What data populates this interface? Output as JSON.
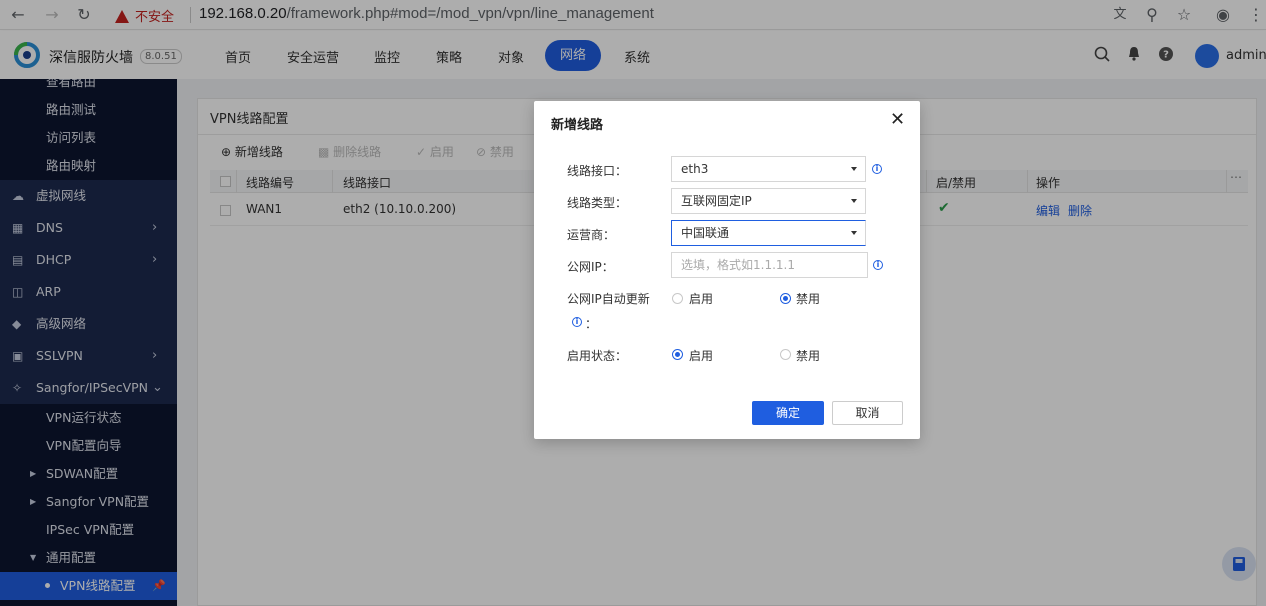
{
  "browser": {
    "insecure_label": "不安全",
    "url_host": "192.168.0.20",
    "url_path": "/framework.php#mod=/mod_vpn/vpn/line_management"
  },
  "app": {
    "brand": "深信服防火墙",
    "version": "8.0.51",
    "nav": [
      "首页",
      "安全运营",
      "监控",
      "策略",
      "对象",
      "网络",
      "系统"
    ],
    "nav_active": "网络",
    "user": "admin"
  },
  "sidebar": {
    "items_top": [
      "查看路由",
      "路由测试",
      "访问列表",
      "路由映射"
    ],
    "groups": [
      {
        "label": "虚拟网线",
        "icon": "cloud-icon"
      },
      {
        "label": "DNS",
        "icon": "dns-icon"
      },
      {
        "label": "DHCP",
        "icon": "dhcp-icon"
      },
      {
        "label": "ARP",
        "icon": "arp-icon"
      },
      {
        "label": "高级网络",
        "icon": "diamond-icon"
      },
      {
        "label": "SSLVPN",
        "icon": "sslvpn-icon"
      },
      {
        "label": "Sangfor/IPSecVPN",
        "icon": "network-icon"
      }
    ],
    "vpn_items": [
      "VPN运行状态",
      "VPN配置向导",
      "SDWAN配置",
      "Sangfor VPN配置",
      "IPSec VPN配置",
      "通用配置"
    ],
    "active_item": "VPN线路配置"
  },
  "panel": {
    "title": "VPN线路配置",
    "toolbar": {
      "add": "新增线路",
      "delete": "删除线路",
      "enable": "启用",
      "disable": "禁用"
    },
    "columns": [
      "线路编号",
      "线路接口",
      "启/禁用",
      "操作"
    ],
    "rows": [
      {
        "id": "WAN1",
        "iface": "eth2 (10.10.0.200)",
        "enabled": true,
        "edit": "编辑",
        "delete": "删除"
      }
    ]
  },
  "dialog": {
    "title": "新增线路",
    "fields": {
      "iface_label": "线路接口：",
      "iface_value": "eth3",
      "type_label": "线路类型：",
      "type_value": "互联网固定IP",
      "isp_label": "运营商：",
      "isp_value": "中国联通",
      "public_ip_label": "公网IP：",
      "public_ip_placeholder": "选填，格式如1.1.1.1",
      "auto_update_label": "公网IP自动更新",
      "auto_update_colon": "：",
      "status_label": "启用状态：",
      "enable": "启用",
      "disable": "禁用"
    },
    "auto_update_selected": "禁用",
    "status_selected": "启用",
    "ok": "确定",
    "cancel": "取消"
  },
  "colors": {
    "accent": "#1f5ee0",
    "sidebar": "#0c1530",
    "success": "#2a9d4b"
  }
}
